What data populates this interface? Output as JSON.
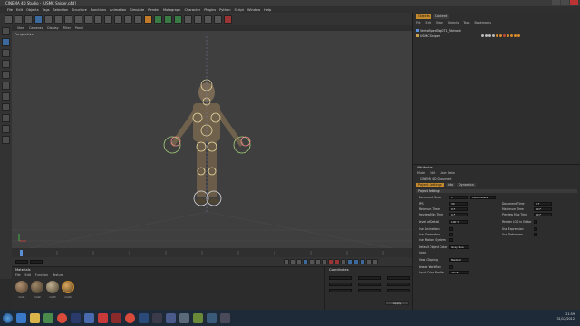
{
  "window": {
    "title": "CINEMA 4D Studio - [USMC Sniper.c4d]"
  },
  "menu": [
    "File",
    "Edit",
    "Objects",
    "Tags",
    "Selection",
    "Structure",
    "Functions",
    "Animation",
    "Simulate",
    "Render",
    "Motograph",
    "Character",
    "Plugins",
    "Python",
    "Script",
    "Window",
    "Help"
  ],
  "viewport": {
    "menu": [
      "View",
      "Cameras",
      "Display",
      "Filter",
      "Panel"
    ],
    "label": "Perspective"
  },
  "materials": {
    "title": "Materials",
    "menu": [
      "File",
      "Edit",
      "Function",
      "Texture"
    ],
    "items": [
      "mat1",
      "mat2",
      "mat3",
      "mat4"
    ]
  },
  "coordinates": {
    "title": "Coordinates",
    "apply_label": "Apply"
  },
  "objects_panel": {
    "tabs": [
      "Objects",
      "Content"
    ],
    "menu": [
      "File",
      "Edit",
      "View",
      "Objects",
      "Tags",
      "Bookmarks"
    ],
    "rows": [
      {
        "label": "VertsBipedTag0T1_Ribtrack"
      },
      {
        "label": "USMC Sniper"
      }
    ]
  },
  "attributes": {
    "title": "Attributes",
    "menu": [
      "Mode",
      "Edit",
      "User Data"
    ],
    "object_name": "CINEMA 4D Document",
    "tabs": [
      "Project Settings",
      "Info",
      "Dynamics"
    ],
    "section": "Project Settings",
    "rows_left": [
      {
        "label": "Document Scale",
        "value": "1"
      },
      {
        "label": "FPS",
        "value": "30"
      },
      {
        "label": "Minimum Time",
        "value": "0 F"
      },
      {
        "label": "Preview Min Time",
        "value": "0 F"
      },
      {
        "label": "Level of Detail",
        "value": "100 %"
      },
      {
        "label": "Use Animation",
        "value": ""
      },
      {
        "label": "Use Generators",
        "value": ""
      },
      {
        "label": "Use Motion System",
        "value": ""
      },
      {
        "label": "Default Object Color",
        "value": "Gray Blue"
      },
      {
        "label": "Color",
        "value": ""
      },
      {
        "label": "View Clipping",
        "value": "Medium"
      },
      {
        "label": "Linear Workflow",
        "value": ""
      },
      {
        "label": "Input Color Profile",
        "value": "sRGB"
      }
    ],
    "rows_right": [
      {
        "label": "Centimeters",
        "value": ""
      },
      {
        "label": "Document Time",
        "value": "0 F"
      },
      {
        "label": "Maximum Time",
        "value": "90 F"
      },
      {
        "label": "Preview Max Time",
        "value": "90 F"
      },
      {
        "label": "Render LOD in Editor",
        "value": ""
      },
      {
        "label": "Use Expression",
        "value": ""
      },
      {
        "label": "Use Deformers",
        "value": ""
      }
    ]
  },
  "taskbar": {
    "time": "21:59",
    "date": "31/12/2012"
  },
  "colors": {
    "accent": "#c68a2e",
    "selection": "#3d6a9c"
  }
}
